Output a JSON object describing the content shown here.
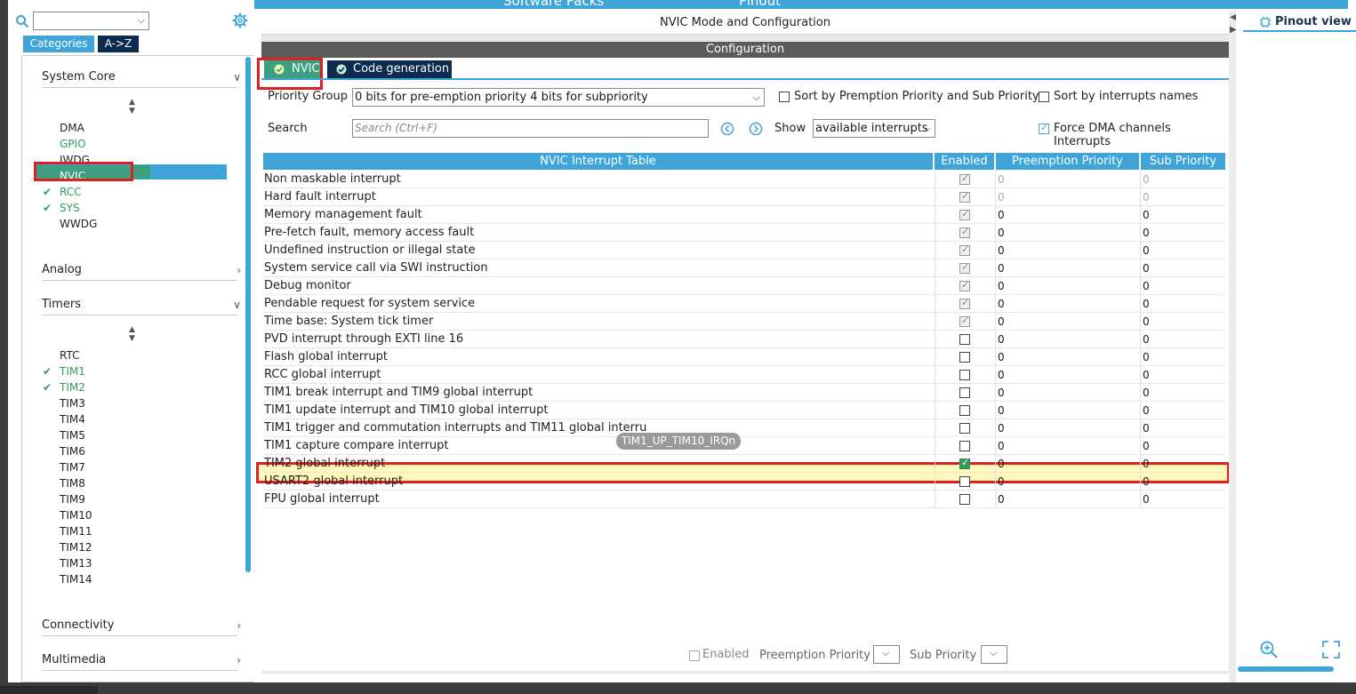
{
  "top_banner": {
    "left_text": "Software Packs",
    "right_text": "Pinout"
  },
  "left_panel": {
    "tabs": [
      "Categories",
      "A->Z"
    ],
    "search_value": "",
    "system_core": {
      "title": "System Core",
      "items": [
        "DMA",
        "GPIO",
        "IWDG",
        "NVIC",
        "RCC",
        "SYS",
        "WWDG"
      ]
    },
    "analog": {
      "title": "Analog"
    },
    "timers": {
      "title": "Timers",
      "items": [
        "RTC",
        "TIM1",
        "TIM2",
        "TIM3",
        "TIM4",
        "TIM5",
        "TIM6",
        "TIM7",
        "TIM8",
        "TIM9",
        "TIM10",
        "TIM11",
        "TIM12",
        "TIM13",
        "TIM14"
      ]
    },
    "connectivity": {
      "title": "Connectivity"
    },
    "multimedia": {
      "title": "Multimedia"
    }
  },
  "main": {
    "title": "NVIC Mode and Configuration",
    "config_label": "Configuration",
    "tabs": {
      "nvic": "NVIC",
      "codegen": "Code generation"
    },
    "priority_group_label": "Priority Group",
    "priority_group_value": "0 bits for pre-emption priority 4 bits for subpriority",
    "sort_premption_label": "Sort by Premption Priority and Sub Priority",
    "sort_names_label": "Sort by interrupts names",
    "search_label": "Search",
    "search_placeholder": "Search (Ctrl+F)",
    "show_label": "Show",
    "show_value": "available interrupts",
    "force_dma_label": "Force DMA channels Interrupts",
    "table": {
      "headers": [
        "NVIC Interrupt Table",
        "Enabled",
        "Preemption Priority",
        "Sub Priority"
      ],
      "rows": [
        {
          "name": "Non maskable interrupt",
          "pre": "0",
          "sub": "0"
        },
        {
          "name": "Hard fault interrupt",
          "pre": "0",
          "sub": "0"
        },
        {
          "name": "Memory management fault",
          "pre": "0",
          "sub": "0"
        },
        {
          "name": "Pre-fetch fault, memory access fault",
          "pre": "0",
          "sub": "0"
        },
        {
          "name": "Undefined instruction or illegal state",
          "pre": "0",
          "sub": "0"
        },
        {
          "name": "System service call via SWI instruction",
          "pre": "0",
          "sub": "0"
        },
        {
          "name": "Debug monitor",
          "pre": "0",
          "sub": "0"
        },
        {
          "name": "Pendable request for system service",
          "pre": "0",
          "sub": "0"
        },
        {
          "name": "Time base: System tick timer",
          "pre": "0",
          "sub": "0"
        },
        {
          "name": "PVD interrupt through EXTI line 16",
          "pre": "0",
          "sub": "0"
        },
        {
          "name": "Flash global interrupt",
          "pre": "0",
          "sub": "0"
        },
        {
          "name": "RCC global interrupt",
          "pre": "0",
          "sub": "0"
        },
        {
          "name": "TIM1 break interrupt and TIM9 global interrupt",
          "pre": "0",
          "sub": "0"
        },
        {
          "name": "TIM1 update interrupt and TIM10 global interrupt",
          "pre": "0",
          "sub": "0"
        },
        {
          "name": "TIM1 trigger and commutation interrupts and TIM11 global interru",
          "pre": "0",
          "sub": "0"
        },
        {
          "name": "TIM1 capture compare interrupt",
          "pre": "0",
          "sub": "0"
        },
        {
          "name": "TIM2 global interrupt",
          "pre": "0",
          "sub": "0"
        },
        {
          "name": "USART2 global interrupt",
          "pre": "0",
          "sub": "0"
        },
        {
          "name": "FPU global interrupt",
          "pre": "0",
          "sub": "0"
        }
      ]
    },
    "tooltip": "TIM1_UP_TIM10_IRQn",
    "bottom": {
      "enabled_label": "Enabled",
      "preemption_label": "Preemption Priority",
      "sub_label": "Sub Priority"
    }
  },
  "right_panel": {
    "tab_label": "Pinout view"
  },
  "colors": {
    "accent": "#3fa4d8",
    "dark_navy": "#0b2b4f",
    "green": "#2e9e5a",
    "red_box": "#e02020",
    "highlight_row": "#fff8b8"
  }
}
